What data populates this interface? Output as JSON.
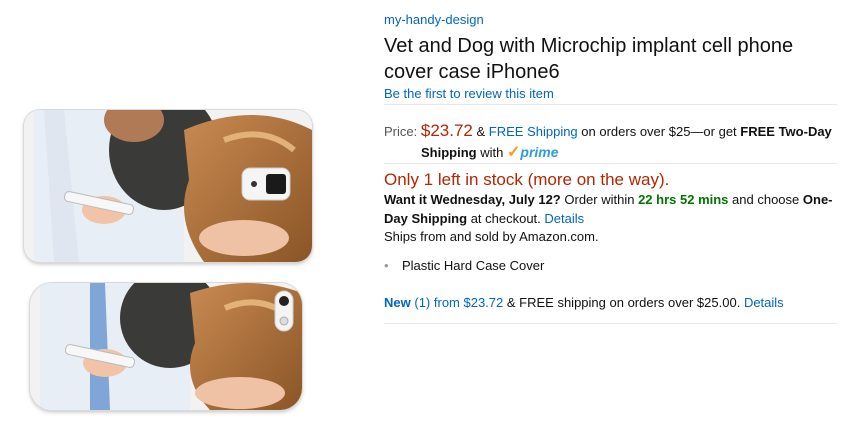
{
  "product": {
    "brand": "my-handy-design",
    "title": "Vet and Dog with Microchip implant cell phone cover case iPhone6",
    "review_link": "Be the first to review this item"
  },
  "price": {
    "label": "Price:",
    "amount": "$23.72",
    "amp": "&",
    "free_shipping": "FREE Shipping",
    "on_orders": "on orders over $25—or get",
    "two_day_a": "FREE Two-Day",
    "two_day_b": "Shipping",
    "with": "with",
    "prime_check": "✓",
    "prime_word": "prime"
  },
  "stock": "Only 1 left in stock (more on the way).",
  "delivery": {
    "want_it": "Want it Wednesday, July 12?",
    "order_within": "Order within",
    "countdown": "22 hrs 52 mins",
    "and_choose": "and choose",
    "one_day_a": "One-",
    "one_day_b": "Day Shipping",
    "at_checkout": "at checkout.",
    "details": "Details"
  },
  "ships_from": "Ships from and sold by Amazon.com.",
  "bullets": [
    "Plastic Hard Case Cover"
  ],
  "new_offer": {
    "new_label": "New",
    "count": "(1)",
    "from": "from",
    "price": "$23.72",
    "shipping_text": "& FREE shipping on orders over $25.00.",
    "details": "Details"
  },
  "colors": {
    "link": "#0066c0",
    "price": "#b12704",
    "green": "#007600",
    "prime": "#2b9ed8"
  }
}
